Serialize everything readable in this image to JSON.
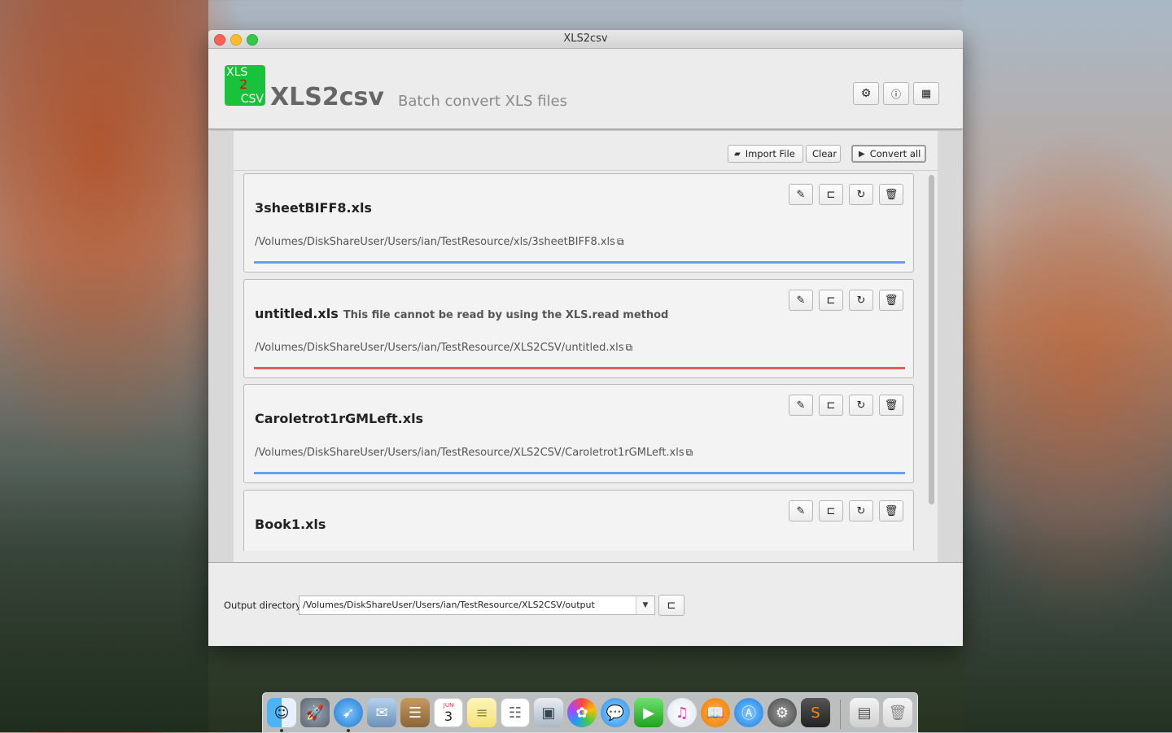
{
  "window": {
    "title": "XLS2csv"
  },
  "header": {
    "logo": {
      "line1": "XLS",
      "line2": "2",
      "line3": "CSV"
    },
    "app_name": "XLS2csv",
    "tagline": "Batch convert XLS files"
  },
  "toolbar": {
    "import_label": "Import File",
    "clear_label": "Clear",
    "convert_label": "Convert all"
  },
  "files": [
    {
      "name": "3sheetBIFF8.xls",
      "error": "",
      "path": "/Volumes/DiskShareUser/Users/ian/TestResource/xls/3sheetBIFF8.xls",
      "status": "ok"
    },
    {
      "name": "untitled.xls",
      "error": "This file cannot be read by using the XLS.read method",
      "path": "/Volumes/DiskShareUser/Users/ian/TestResource/XLS2CSV/untitled.xls",
      "status": "error"
    },
    {
      "name": "Caroletrot1rGMLeft.xls",
      "error": "",
      "path": "/Volumes/DiskShareUser/Users/ian/TestResource/XLS2CSV/Caroletrot1rGMLeft.xls",
      "status": "ok"
    },
    {
      "name": "Book1.xls",
      "error": "",
      "path": "",
      "status": "ok"
    }
  ],
  "output": {
    "label": "Output directory",
    "value": "/Volumes/DiskShareUser/Users/ian/TestResource/XLS2CSV/output"
  },
  "colors": {
    "progress_ok": "#6a9ee8",
    "progress_error": "#e85a5a",
    "logo_green": "#19c23a"
  },
  "dock": {
    "calendar_day": "3",
    "calendar_month": "JUN"
  }
}
